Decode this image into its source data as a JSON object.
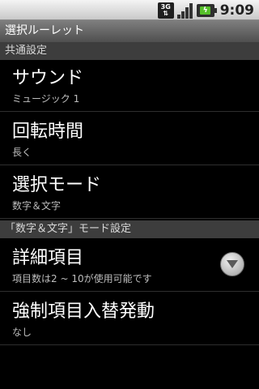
{
  "status_bar": {
    "network_label": "3G",
    "time": "9:09",
    "icons": [
      "3g-icon",
      "signal-icon",
      "battery-charging-icon"
    ]
  },
  "app": {
    "title": "選択ルーレット"
  },
  "sections": [
    {
      "header": "共通設定",
      "items": [
        {
          "title": "サウンド",
          "summary": "ミュージック 1"
        },
        {
          "title": "回転時間",
          "summary": "長く"
        },
        {
          "title": "選択モード",
          "summary": "数字＆文字"
        }
      ]
    },
    {
      "header": "「数字＆文字」モード設定",
      "items": [
        {
          "title": "詳細項目",
          "summary": "項目数は2 ~ 10が使用可能です",
          "icon": "dropdown-icon"
        },
        {
          "title": "強制項目入替発動",
          "summary": "なし"
        }
      ]
    }
  ],
  "colors": {
    "status_bar": "#d9d9d9",
    "title_bar": "#5f5f5f",
    "section_header": "#3d3d3d",
    "background": "#000000",
    "battery": "#56c02a"
  }
}
